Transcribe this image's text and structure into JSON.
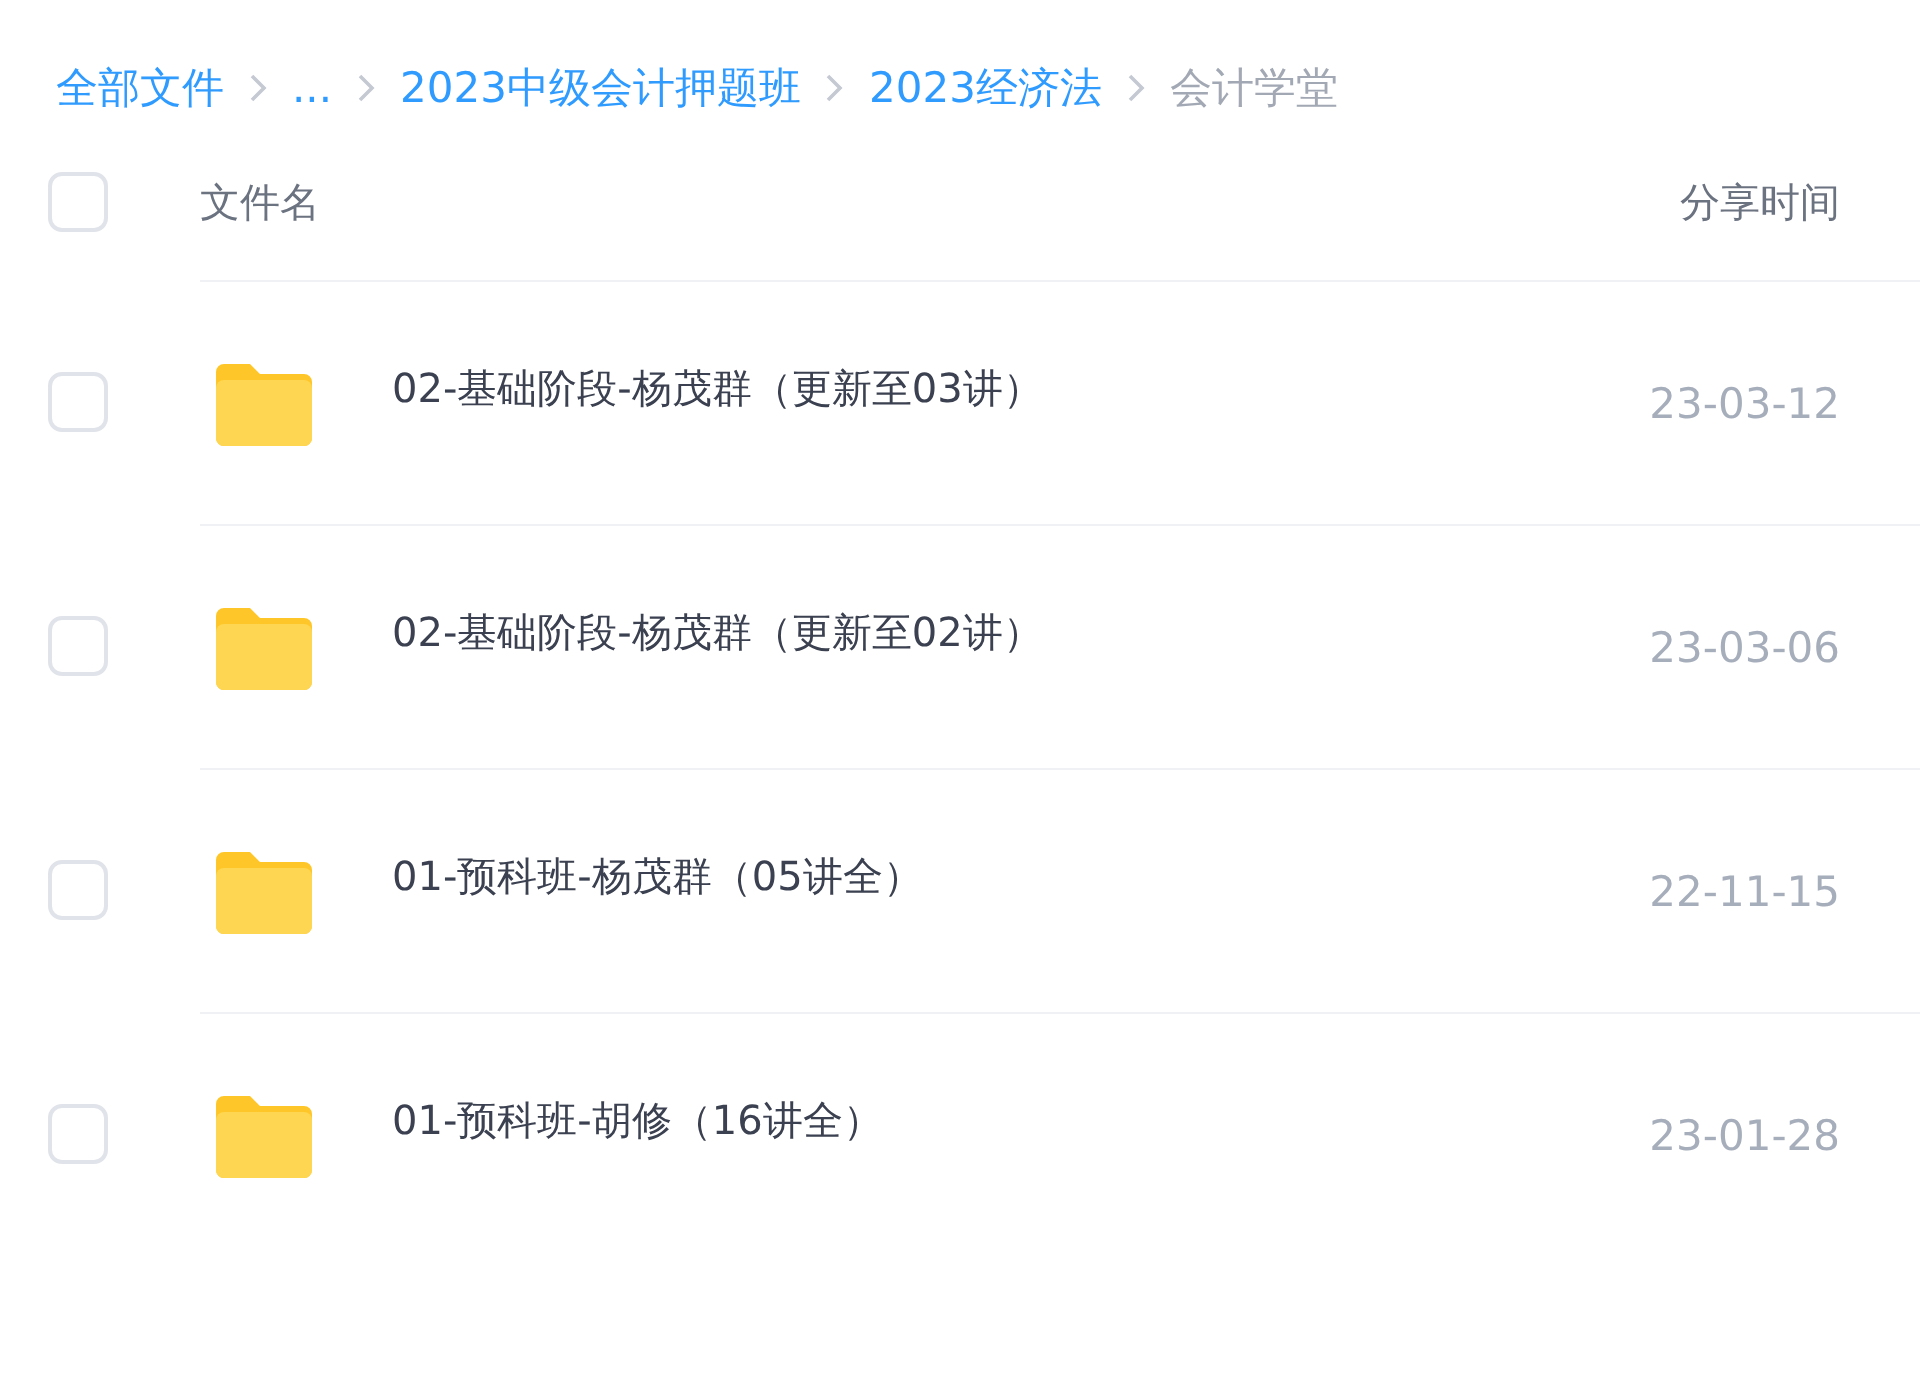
{
  "breadcrumb": [
    {
      "label": "全部文件",
      "current": false
    },
    {
      "label": "...",
      "current": false
    },
    {
      "label": "2023中级会计押题班",
      "current": false
    },
    {
      "label": "2023经济法",
      "current": false
    },
    {
      "label": "会计学堂",
      "current": true
    }
  ],
  "header": {
    "checked": false,
    "name": "文件名",
    "time": "分享时间"
  },
  "rows": [
    {
      "checked": false,
      "name": "02-基础阶段-杨茂群（更新至03讲）",
      "time": "23-03-12"
    },
    {
      "checked": false,
      "name": "02-基础阶段-杨茂群（更新至02讲）",
      "time": "23-03-06"
    },
    {
      "checked": false,
      "name": "01-预科班-杨茂群（05讲全）",
      "time": "22-11-15"
    },
    {
      "checked": false,
      "name": "01-预科班-胡修（16讲全）",
      "time": "23-01-28"
    }
  ]
}
